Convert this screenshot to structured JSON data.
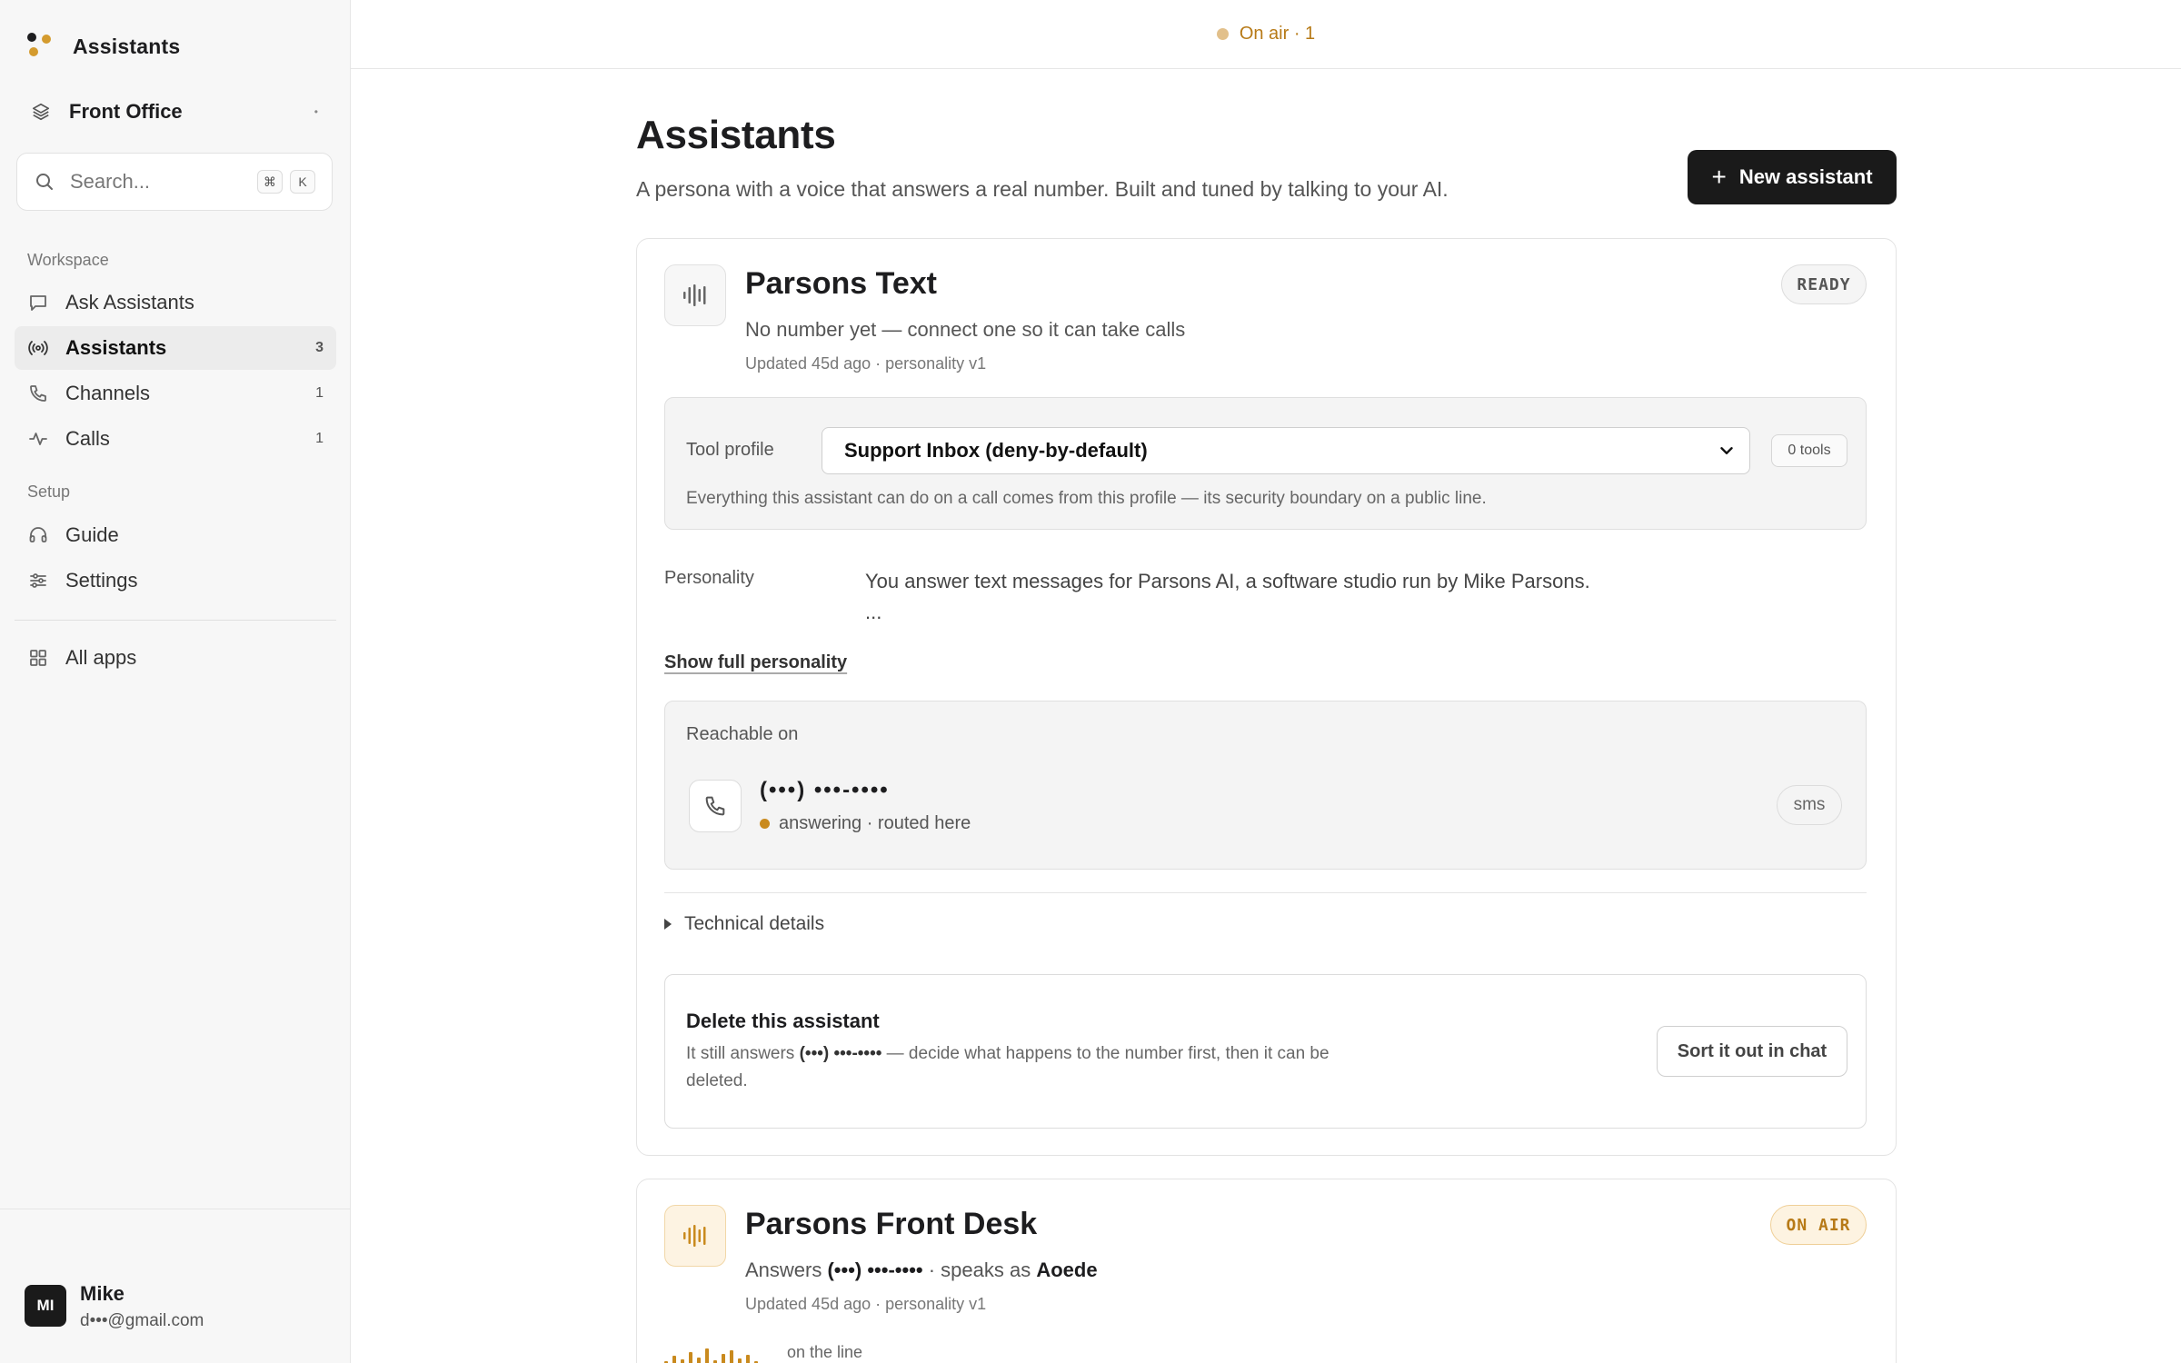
{
  "app": {
    "title": "Assistants"
  },
  "workspace": {
    "name": "Front Office"
  },
  "search": {
    "placeholder": "Search...",
    "shortcut_mod": "⌘",
    "shortcut_key": "K"
  },
  "sidebar": {
    "workspace_heading": "Workspace",
    "setup_heading": "Setup",
    "items": [
      {
        "label": "Ask Assistants",
        "count": ""
      },
      {
        "label": "Assistants",
        "count": "3"
      },
      {
        "label": "Channels",
        "count": "1"
      },
      {
        "label": "Calls",
        "count": "1"
      },
      {
        "label": "Guide",
        "count": ""
      },
      {
        "label": "Settings",
        "count": ""
      },
      {
        "label": "All apps",
        "count": ""
      }
    ]
  },
  "user": {
    "initials": "MI",
    "name": "Mike",
    "email": "d•••@gmail.com"
  },
  "topbar": {
    "status": "On air · 1"
  },
  "page": {
    "title": "Assistants",
    "subtitle": "A persona with a voice that answers a real number. Built and tuned by talking to your AI.",
    "new_button": "New assistant"
  },
  "assistants": [
    {
      "name": "Parsons Text",
      "status": "READY",
      "description": "No number yet — connect one so it can take calls",
      "meta": "Updated 45d ago · personality v1",
      "tool_profile_label": "Tool profile",
      "tool_profile_value": "Support Inbox (deny-by-default)",
      "tools_count": "0 tools",
      "tool_note": "Everything this assistant can do on a call comes from this profile — its security boundary on a public line.",
      "personality_label": "Personality",
      "personality_text": "You answer text messages for Parsons AI, a software studio run by Mike Parsons.",
      "personality_more": "...",
      "show_full": "Show full personality",
      "reachable_label": "Reachable on",
      "number": "(•••) •••-••••",
      "number_status": "answering · routed here",
      "channel": "sms",
      "technical": "Technical details",
      "delete_title": "Delete this assistant",
      "delete_text_pre": "It still answers",
      "delete_text_number": "(•••) •••-••••",
      "delete_text_post": "— decide what happens to the number first, then it can be deleted.",
      "delete_button": "Sort it out in chat"
    },
    {
      "name": "Parsons Front Desk",
      "status": "ON AIR",
      "desc_pre": "Answers",
      "desc_number": "(•••) •••-••••",
      "desc_mid": "· speaks as",
      "desc_voice": "Aoede",
      "meta": "Updated 45d ago · personality v1",
      "live_label": "on the line"
    }
  ],
  "colors": {
    "accent": "#c98a1e",
    "primary_button": "#1a1a1a",
    "sidebar_bg": "#f7f7f7"
  }
}
